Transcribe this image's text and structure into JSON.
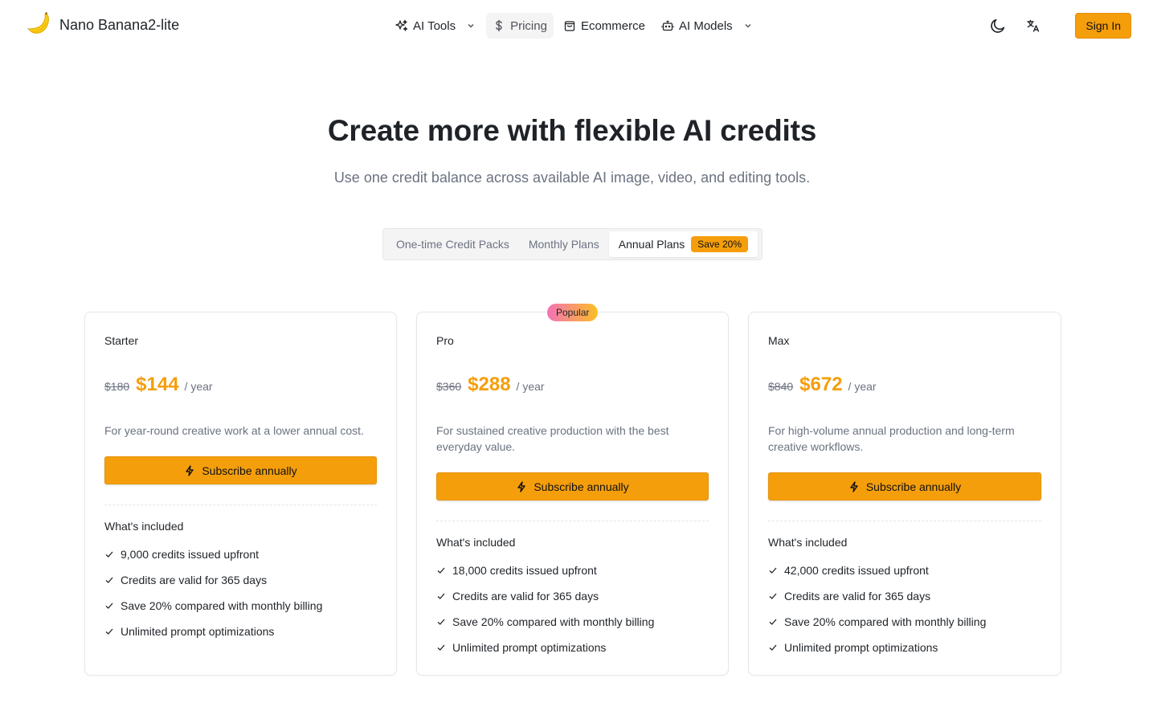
{
  "brand": {
    "name": "Nano Banana2-lite",
    "logo_icon": "banana-icon"
  },
  "nav": {
    "items": [
      {
        "label": "AI Tools",
        "icon": "sparkles-icon",
        "has_dropdown": true
      },
      {
        "label": "Pricing",
        "icon": "dollar-icon",
        "active": true
      },
      {
        "label": "Ecommerce",
        "icon": "shopping-bag-icon"
      },
      {
        "label": "AI Models",
        "icon": "bot-icon",
        "has_dropdown": true
      }
    ]
  },
  "header": {
    "sign_in_label": "Sign In",
    "theme_icon": "moon-icon",
    "language_icon": "translate-icon"
  },
  "hero": {
    "title": "Create more with flexible AI credits",
    "subtitle": "Use one credit balance across available AI image, video, and editing tools."
  },
  "tabs": {
    "items": [
      "One-time Credit Packs",
      "Monthly Plans",
      "Annual Plans"
    ],
    "active": "Annual Plans",
    "save_badge": "Save 20%"
  },
  "colors": {
    "accent": "#f59e0b",
    "muted_text": "#6b7280",
    "border": "#e5e7eb"
  },
  "plans": [
    {
      "name": "Starter",
      "old_price": "$180",
      "price": "$144",
      "period": "/ year",
      "description": "For year-round creative work at a lower annual cost.",
      "cta": "Subscribe annually",
      "included_title": "What's included",
      "features": [
        "9,000 credits issued upfront",
        "Credits are valid for 365 days",
        "Save 20% compared with monthly billing",
        "Unlimited prompt optimizations"
      ]
    },
    {
      "name": "Pro",
      "badge": "Popular",
      "old_price": "$360",
      "price": "$288",
      "period": "/ year",
      "description": "For sustained creative production with the best everyday value.",
      "cta": "Subscribe annually",
      "included_title": "What's included",
      "features": [
        "18,000 credits issued upfront",
        "Credits are valid for 365 days",
        "Save 20% compared with monthly billing",
        "Unlimited prompt optimizations"
      ]
    },
    {
      "name": "Max",
      "old_price": "$840",
      "price": "$672",
      "period": "/ year",
      "description": "For high-volume annual production and long-term creative workflows.",
      "cta": "Subscribe annually",
      "included_title": "What's included",
      "features": [
        "42,000 credits issued upfront",
        "Credits are valid for 365 days",
        "Save 20% compared with monthly billing",
        "Unlimited prompt optimizations"
      ]
    }
  ]
}
